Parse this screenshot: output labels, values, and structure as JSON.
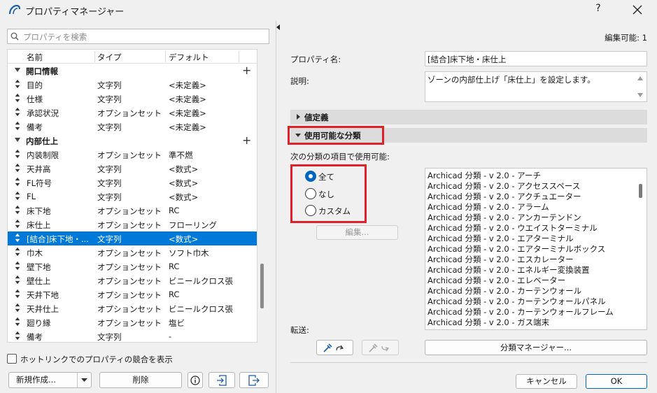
{
  "window": {
    "title": "プロパティマネージャー",
    "help": "?"
  },
  "search": {
    "placeholder": "プロパティを検索"
  },
  "table": {
    "headers": [
      "名前",
      "タイプ",
      "デフォルト"
    ],
    "rows": [
      {
        "kind": "group",
        "name": "開口情報"
      },
      {
        "kind": "item",
        "name": "目的",
        "type": "文字列",
        "default": "<未定義>"
      },
      {
        "kind": "item",
        "name": "仕様",
        "type": "文字列",
        "default": "<未定義>"
      },
      {
        "kind": "item",
        "name": "承認状況",
        "type": "オプションセット",
        "default": "<未定義>"
      },
      {
        "kind": "item",
        "name": "備考",
        "type": "文字列",
        "default": "<未定義>"
      },
      {
        "kind": "group",
        "name": "内部仕上"
      },
      {
        "kind": "item",
        "name": "内装制限",
        "type": "オプションセット",
        "default": "準不燃"
      },
      {
        "kind": "item",
        "name": "天井高",
        "type": "文字列",
        "default": "<数式>"
      },
      {
        "kind": "item",
        "name": "FL符号",
        "type": "文字列",
        "default": "<数式>"
      },
      {
        "kind": "item",
        "name": "FL",
        "type": "文字列",
        "default": "<数式>"
      },
      {
        "kind": "item",
        "name": "床下地",
        "type": "オプションセット",
        "default": "RC"
      },
      {
        "kind": "item",
        "name": "床仕上",
        "type": "オプションセット",
        "default": "フローリング"
      },
      {
        "kind": "item",
        "name": "[結合]床下地・...",
        "type": "文字列",
        "default": "<数式>",
        "selected": true
      },
      {
        "kind": "item",
        "name": "巾木",
        "type": "オプションセット",
        "default": "ソフト巾木"
      },
      {
        "kind": "item",
        "name": "壁下地",
        "type": "オプションセット",
        "default": "RC"
      },
      {
        "kind": "item",
        "name": "壁仕上",
        "type": "オプションセット",
        "default": "ビニールクロス張"
      },
      {
        "kind": "item",
        "name": "天井下地",
        "type": "オプションセット",
        "default": "RC"
      },
      {
        "kind": "item",
        "name": "天井仕上",
        "type": "オプションセット",
        "default": "ビニールクロス張"
      },
      {
        "kind": "item",
        "name": "廻り縁",
        "type": "オプションセット",
        "default": "塩ビ"
      },
      {
        "kind": "item",
        "name": "備考",
        "type": "文字列",
        "default": "-"
      }
    ]
  },
  "left_footer": {
    "hotlink_label": "ホットリンクでのプロパティの競合を表示",
    "new_label": "新規作成...",
    "delete_label": "削除"
  },
  "right": {
    "editable": "編集可能: 1",
    "property_name_label": "プロパティ名:",
    "property_name_value": "[結合]床下地・床仕上",
    "description_label": "説明:",
    "description_value": "ゾーンの内部仕上げ「床仕上」を設定します。",
    "section_value_def": "値定義",
    "section_classification": "使用可能な分類",
    "available_label": "次の分類の項目で使用可能:",
    "radio_all": "全て",
    "radio_none": "なし",
    "radio_custom": "カスタム",
    "edit_button": "編集...",
    "transfer_label": "転送:",
    "class_manager_button": "分類マネージャー...",
    "cancel_button": "キャンセル",
    "ok_button": "OK",
    "classifications": [
      "Archicad 分類 - v 2.0 - アーチ",
      "Archicad 分類 - v 2.0 - アクセススペース",
      "Archicad 分類 - v 2.0 - アクチュエーター",
      "Archicad 分類 - v 2.0 - アラーム",
      "Archicad 分類 - v 2.0 - アンカーテンドン",
      "Archicad 分類 - v 2.0 - ウエイストターミナル",
      "Archicad 分類 - v 2.0 - エアターミナル",
      "Archicad 分類 - v 2.0 - エアターミナルボックス",
      "Archicad 分類 - v 2.0 - エスカレーター",
      "Archicad 分類 - v 2.0 - エネルギー変換装置",
      "Archicad 分類 - v 2.0 - エレベーター",
      "Archicad 分類 - v 2.0 - カーテンウォール",
      "Archicad 分類 - v 2.0 - カーテンウォールパネル",
      "Archicad 分類 - v 2.0 - カーテンウォールフレーム",
      "Archicad 分類 - v 2.0 - ガス端末"
    ]
  }
}
